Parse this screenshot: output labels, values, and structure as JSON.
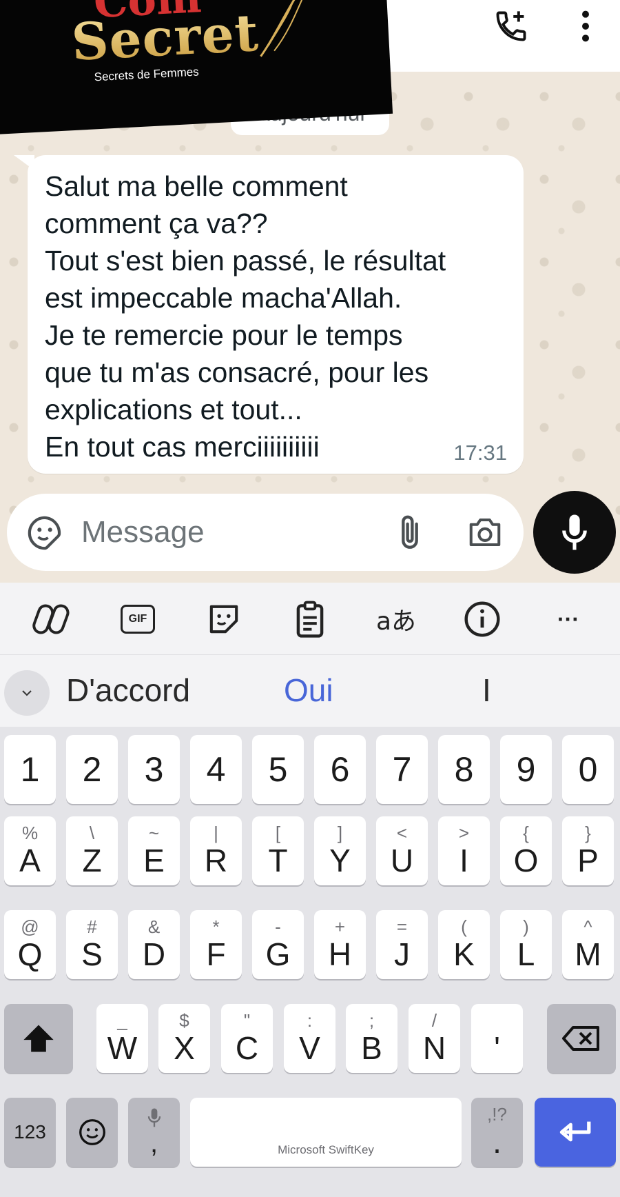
{
  "logo": {
    "word_top": "Com",
    "word_main": "Secret",
    "tagline": "Secrets de Femmes"
  },
  "header": {
    "icons": [
      "add-call-icon",
      "more-vert-icon"
    ]
  },
  "chat": {
    "date_chip": "Aujourd'hui",
    "message": {
      "text": "Salut ma belle comment\ncomment ça va??\nTout s'est bien passé, le résultat\nest impeccable macha'Allah.\nJe te remercie pour le temps\nque tu m'as consacré, pour les\nexplications et tout...\nEn tout cas merciiiiiiiiii",
      "time": "17:31"
    },
    "composer": {
      "placeholder": "Message"
    }
  },
  "keyboard_toolbar": {
    "gif_label": "GIF",
    "translate_label": "aあ",
    "more_label": "···"
  },
  "suggestions": [
    "D'accord",
    "Oui",
    "I"
  ],
  "keyboard": {
    "number_row": [
      "1",
      "2",
      "3",
      "4",
      "5",
      "6",
      "7",
      "8",
      "9",
      "0"
    ],
    "row1": [
      {
        "pri": "A",
        "sec": "%"
      },
      {
        "pri": "Z",
        "sec": "\\"
      },
      {
        "pri": "E",
        "sec": "~"
      },
      {
        "pri": "R",
        "sec": "|"
      },
      {
        "pri": "T",
        "sec": "["
      },
      {
        "pri": "Y",
        "sec": "]"
      },
      {
        "pri": "U",
        "sec": "<"
      },
      {
        "pri": "I",
        "sec": ">"
      },
      {
        "pri": "O",
        "sec": "{"
      },
      {
        "pri": "P",
        "sec": "}"
      }
    ],
    "row2": [
      {
        "pri": "Q",
        "sec": "@"
      },
      {
        "pri": "S",
        "sec": "#"
      },
      {
        "pri": "D",
        "sec": "&"
      },
      {
        "pri": "F",
        "sec": "*"
      },
      {
        "pri": "G",
        "sec": "-"
      },
      {
        "pri": "H",
        "sec": "+"
      },
      {
        "pri": "J",
        "sec": "="
      },
      {
        "pri": "K",
        "sec": "("
      },
      {
        "pri": "L",
        "sec": ")"
      },
      {
        "pri": "M",
        "sec": "^"
      }
    ],
    "row3": [
      {
        "pri": "W",
        "sec": "_"
      },
      {
        "pri": "X",
        "sec": "$"
      },
      {
        "pri": "C",
        "sec": "\""
      },
      {
        "pri": "V",
        "sec": ":"
      },
      {
        "pri": "B",
        "sec": ";"
      },
      {
        "pri": "N",
        "sec": "/"
      },
      {
        "pri": "'",
        "sec": ""
      }
    ],
    "numbers_key": "123",
    "comma_key": ",",
    "space_label": "Microsoft SwiftKey",
    "punct_key": {
      "pri": ".",
      "sec": ",!?"
    }
  }
}
